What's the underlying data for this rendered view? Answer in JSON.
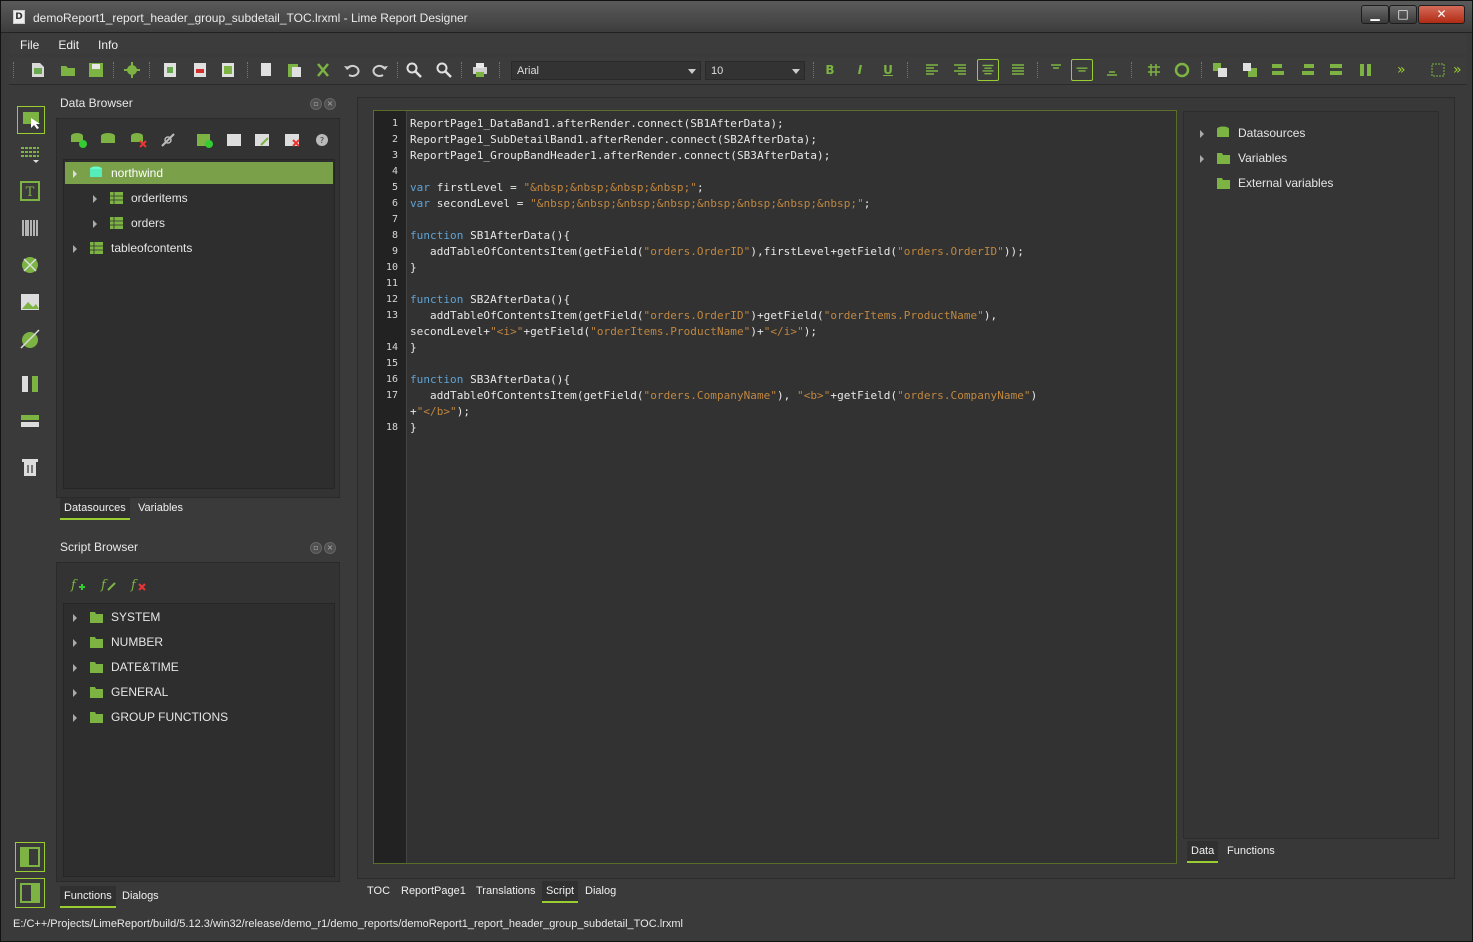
{
  "window": {
    "title": "demoReport1_report_header_group_subdetail_TOC.lrxml - Lime Report Designer",
    "minimize": "▁",
    "maximize": "□",
    "close": "✕"
  },
  "menu": [
    "File",
    "Edit",
    "Info"
  ],
  "toolbar": {
    "font_family": "Arial",
    "font_size": "10",
    "bold": "B",
    "italic": "I",
    "underline": "U",
    "more": "»"
  },
  "data_browser": {
    "title": "Data Browser",
    "tree": [
      {
        "label": "northwind",
        "selected": true,
        "expanded": true
      },
      {
        "label": "orderitems"
      },
      {
        "label": "orders"
      },
      {
        "label": "tableofcontents"
      }
    ],
    "tabs": [
      "Datasources",
      "Variables"
    ],
    "active_tab": "Datasources"
  },
  "script_browser": {
    "title": "Script Browser",
    "items": [
      "SYSTEM",
      "NUMBER",
      "DATE&TIME",
      "GENERAL",
      "GROUP FUNCTIONS"
    ],
    "tabs": [
      "Functions",
      "Dialogs"
    ],
    "active_tab": "Functions"
  },
  "editor": {
    "lines": [
      {
        "n": "1",
        "html": "ReportPage1_DataBand1.afterRender.connect(SB1AfterData);"
      },
      {
        "n": "2",
        "html": "ReportPage1_SubDetailBand1.afterRender.connect(SB2AfterData);"
      },
      {
        "n": "3",
        "html": "ReportPage1_GroupBandHeader1.afterRender.connect(SB3AfterData);"
      },
      {
        "n": "4",
        "html": ""
      },
      {
        "n": "5",
        "html": "<span class=\"kw\">var</span> firstLevel = <span class=\"st\">\"&amp;nbsp;&amp;nbsp;&amp;nbsp;&amp;nbsp;\"</span>;"
      },
      {
        "n": "6",
        "html": "<span class=\"kw\">var</span> secondLevel = <span class=\"st\">\"&amp;nbsp;&amp;nbsp;&amp;nbsp;&amp;nbsp;&amp;nbsp;&amp;nbsp;&amp;nbsp;&amp;nbsp;\"</span>;"
      },
      {
        "n": "7",
        "html": ""
      },
      {
        "n": "8",
        "html": "<span class=\"kw\">function</span> SB1AfterData(){"
      },
      {
        "n": "9",
        "html": "   addTableOfContentsItem(getField(<span class=\"st\">\"orders.OrderID\"</span>),firstLevel+getField(<span class=\"st\">\"orders.OrderID\"</span>));"
      },
      {
        "n": "10",
        "html": "}"
      },
      {
        "n": "11",
        "html": ""
      },
      {
        "n": "12",
        "html": "<span class=\"kw\">function</span> SB2AfterData(){"
      },
      {
        "n": "13",
        "html": "   addTableOfContentsItem(getField(<span class=\"st\">\"orders.OrderID\"</span>)+getField(<span class=\"st\">\"orderItems.ProductName\"</span>),"
      },
      {
        "n": "",
        "html": "secondLevel+<span class=\"st\">\"&lt;i&gt;\"</span>+getField(<span class=\"st\">\"orderItems.ProductName\"</span>)+<span class=\"st\">\"&lt;/i&gt;\"</span>);"
      },
      {
        "n": "14",
        "html": "}"
      },
      {
        "n": "15",
        "html": ""
      },
      {
        "n": "16",
        "html": "<span class=\"kw\">function</span> SB3AfterData(){"
      },
      {
        "n": "17",
        "html": "   addTableOfContentsItem(getField(<span class=\"st\">\"orders.CompanyName\"</span>), <span class=\"st\">\"&lt;b&gt;\"</span>+getField(<span class=\"st\">\"orders.CompanyName\"</span>)"
      },
      {
        "n": "",
        "html": "+<span class=\"st\">\"&lt;/b&gt;\"</span>);"
      },
      {
        "n": "18",
        "html": "}"
      }
    ],
    "tabs": [
      "TOC",
      "ReportPage1",
      "Translations",
      "Script",
      "Dialog"
    ],
    "active_tab": "Script"
  },
  "right_panel": {
    "items": [
      "Datasources",
      "Variables",
      "External variables"
    ],
    "tabs": [
      "Data",
      "Functions"
    ],
    "active_tab": "Data"
  },
  "status": "E:/C++/Projects/LimeReport/build/5.12.3/win32/release/demo_r1/demo_reports/demoReport1_report_header_group_subdetail_TOC.lrxml"
}
